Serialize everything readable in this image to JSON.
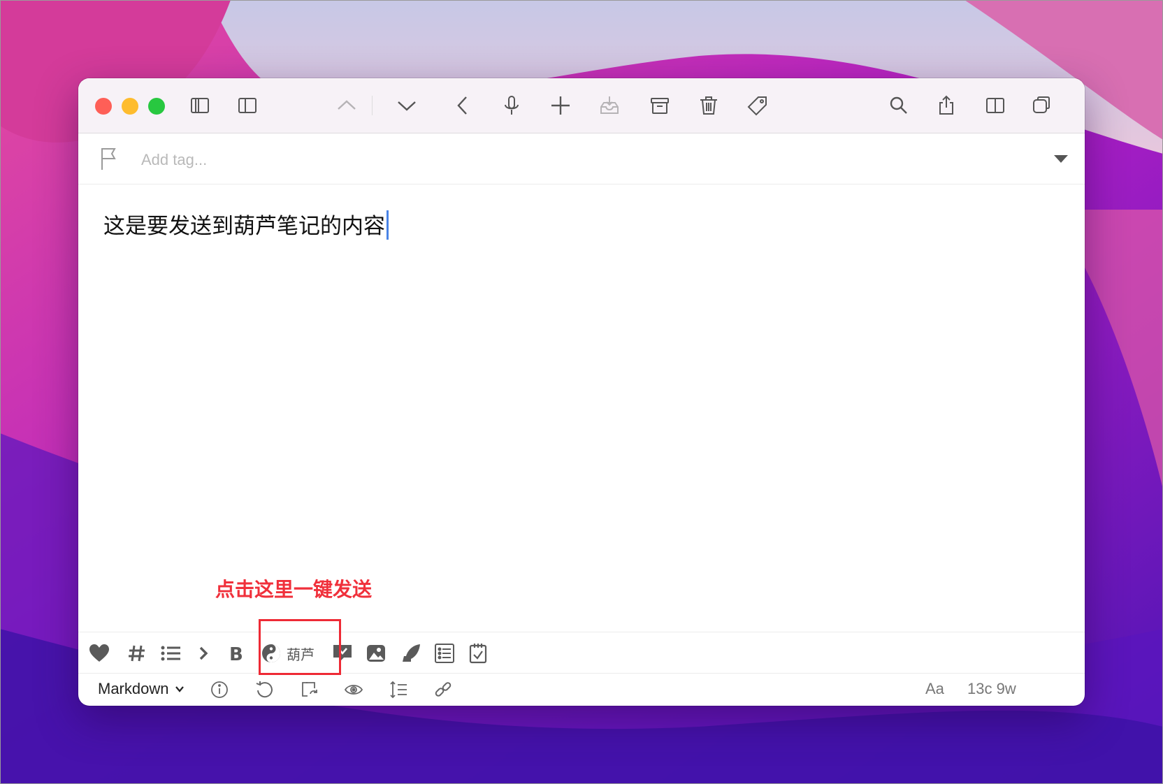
{
  "window": {
    "traffic_lights": {
      "close": "#fe5f57",
      "minimize": "#febc2e",
      "zoom": "#28c840"
    },
    "toolbar": [
      {
        "name": "sidebar-toggle-icon"
      },
      {
        "name": "panel-toggle-icon"
      },
      {
        "name": "chevron-up-icon",
        "disabled": true
      },
      {
        "name": "chevron-down-icon"
      },
      {
        "name": "back-arrow-icon"
      },
      {
        "name": "microphone-icon"
      },
      {
        "name": "plus-icon"
      },
      {
        "name": "inbox-download-icon",
        "disabled": true
      },
      {
        "name": "archive-icon"
      },
      {
        "name": "trash-icon"
      },
      {
        "name": "tag-icon"
      },
      {
        "name": "search-icon"
      },
      {
        "name": "share-icon"
      },
      {
        "name": "right-panel-icon"
      },
      {
        "name": "duplicate-window-icon"
      }
    ]
  },
  "tag_bar": {
    "placeholder": "Add tag...",
    "icon": "flag-icon"
  },
  "editor": {
    "content": "这是要发送到葫芦笔记的内容",
    "caret_color": "#4a84e6"
  },
  "annotation": {
    "text": "点击这里一键发送",
    "color": "#f0303b"
  },
  "format_bar": {
    "items": [
      "heart-icon",
      "hashtag-icon",
      "bullet-list-icon",
      "chevron-right-icon",
      "bold-icon",
      "hulu-icon",
      "speech-bubble-icon",
      "photo-icon",
      "quill-icon",
      "list-box-icon",
      "calendar-check-icon"
    ],
    "hulu_label": "葫芦"
  },
  "status_bar": {
    "mode": "Markdown",
    "font_label": "Aa",
    "counts": "13c 9w",
    "icons": [
      "info-icon",
      "undo-icon",
      "convert-icon",
      "eye-icon",
      "line-spacing-icon",
      "link-icon"
    ]
  }
}
